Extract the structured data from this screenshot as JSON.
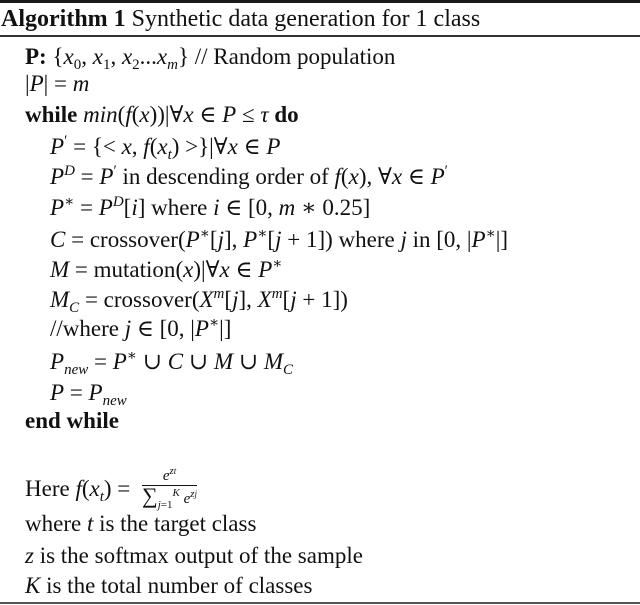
{
  "algorithm": {
    "label": "Algorithm 1",
    "title": "Synthetic data generation for 1 class"
  },
  "lines": {
    "l1": {
      "keyword": "P:",
      "set": "{x0, x1, x2...xm}",
      "comment": "// Random population"
    },
    "l2": {
      "text": "|P| = m"
    },
    "l3": {
      "kw_while": "while",
      "condition": "min(f(x))|∀x ∈ P ≤ τ",
      "kw_do": "do"
    },
    "l4": {
      "text": "P' = {< x, f(xt) >}|∀x ∈ P"
    },
    "l5": {
      "lhs": "P^D = P'",
      "words": "in descending order of",
      "rhs": "f(x), ∀x ∈ P'"
    },
    "l6": {
      "lhs": "P* = P^D[i]",
      "words": "where",
      "rhs": "i ∈ [0, m * 0.25]"
    },
    "l7": {
      "lhs": "C",
      "func": "crossover",
      "args": "(P*[j], P*[j + 1])",
      "words1": "where",
      "var": "j",
      "words2": "in",
      "range": "[0, |P*|]"
    },
    "l8": {
      "lhs": "M",
      "func": "mutation",
      "args": "(x)|∀x ∈ P*"
    },
    "l9": {
      "lhs": "M_C",
      "func": "crossover",
      "args": "(X^m[j], X^m[j + 1])"
    },
    "l10": {
      "comment": "//where",
      "expr": "j ∈ [0, |P*|]"
    },
    "l11": {
      "text": "P_new = P* ∪ C ∪ M ∪ M_C"
    },
    "l12": {
      "text": "P = P_new"
    },
    "l13": {
      "keyword": "end while"
    }
  },
  "notes": {
    "here": "Here",
    "formula_lhs": "f(xt) =",
    "numerator": "e^zt",
    "denominator": "∑ j=1..K e^zj",
    "n1_var": "t",
    "n1_text": "is the target class",
    "n1_prefix": "where",
    "n2_var": "z",
    "n2_text": "is the softmax output of the sample",
    "n3_var": "K",
    "n3_text": "is the total number of classes"
  }
}
